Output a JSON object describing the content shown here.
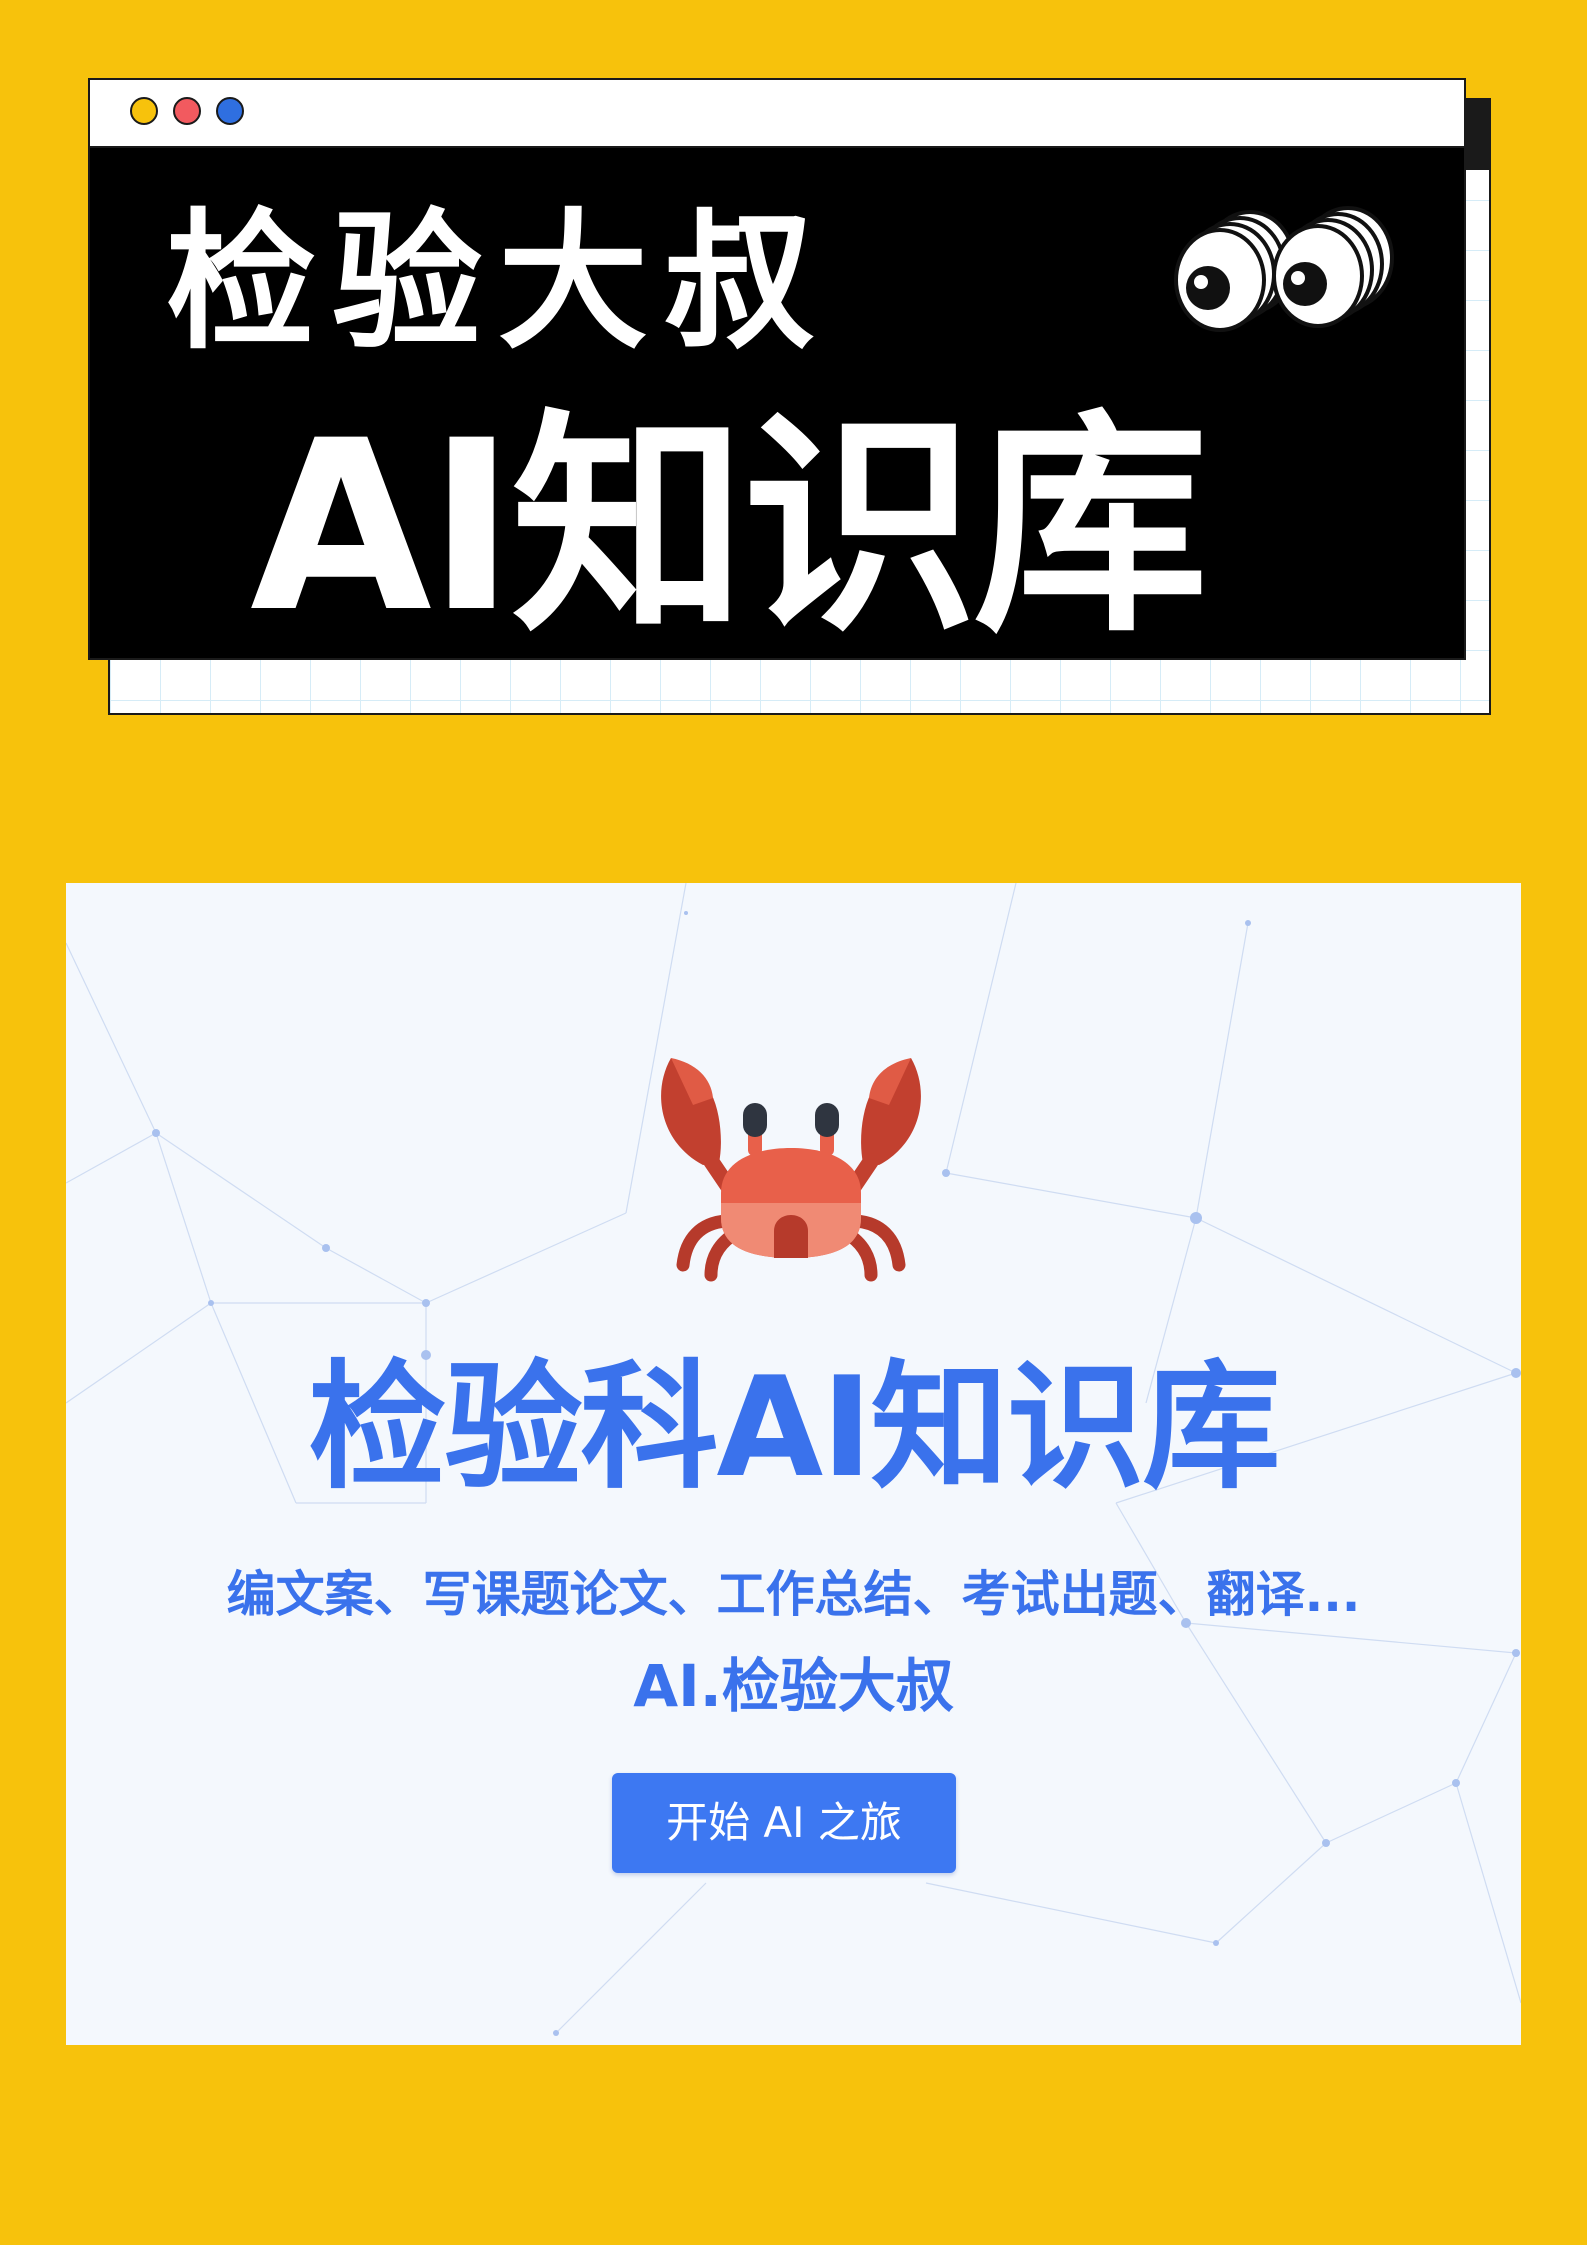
{
  "colors": {
    "page_background": "#f7c20c",
    "banner_background": "#000000",
    "banner_text": "#ffffff",
    "accent_blue": "#3a72ec",
    "button_blue": "#3d78f2",
    "card_background": "#f4f8fd",
    "dot_yellow": "#f7c20c",
    "dot_red": "#f25a5f",
    "dot_blue": "#2f6fe0"
  },
  "banner": {
    "title_line1": "检验大叔",
    "title_line2": "AI知识库",
    "window_controls": [
      "yellow-dot",
      "red-dot",
      "blue-dot"
    ],
    "decoration_icon": "cartoon-eyes-icon"
  },
  "card": {
    "logo_icon": "crab-icon",
    "title": "检验科AI知识库",
    "subtitle": "编文案、写课题论文、工作总结、考试出题、翻译...",
    "author": "AI.检验大叔",
    "start_button_label": "开始 AI 之旅"
  }
}
